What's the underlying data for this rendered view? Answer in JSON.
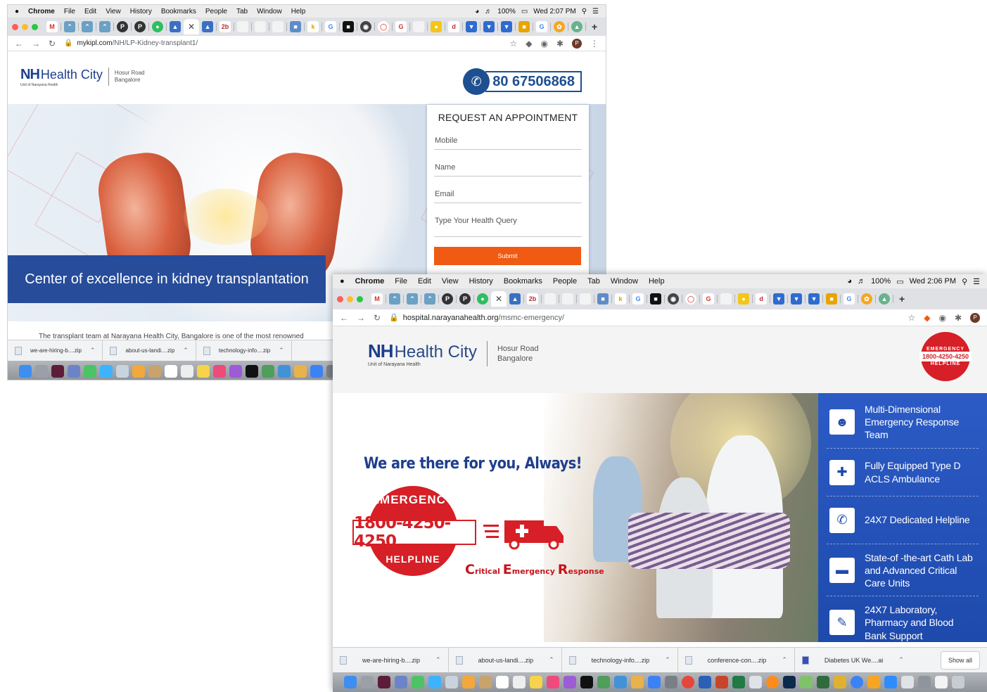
{
  "window_a": {
    "menubar": {
      "apple": "",
      "app": "Chrome",
      "items": [
        "File",
        "Edit",
        "View",
        "History",
        "Bookmarks",
        "People",
        "Tab",
        "Window",
        "Help"
      ],
      "battery": "100%",
      "clock": "Wed 2:07 PM"
    },
    "address": {
      "domain": "mykipl.com",
      "path": "/NH/LP-Kidney-transplant1/"
    },
    "avatar": "P",
    "logo": {
      "nh": "NH",
      "name": "Health City",
      "sub": "Unit of Narayana Health",
      "loc1": "Hosur Road",
      "loc2": "Bangalore"
    },
    "phone": "80 67506868",
    "banner": "Center of excellence in kidney transplantation",
    "form": {
      "title": "REQUEST AN APPOINTMENT",
      "mobile": "Mobile",
      "name": "Name",
      "email": "Email",
      "query": "Type Your Health Query",
      "submit": "Submit"
    },
    "body_text": "The transplant team at Narayana Health City, Bangalore is one of the most renowned",
    "downloads": [
      "we-are-hiring-b....zip",
      "about-us-landi....zip",
      "technology-info....zip"
    ]
  },
  "window_b": {
    "menubar": {
      "app": "Chrome",
      "items": [
        "File",
        "Edit",
        "View",
        "History",
        "Bookmarks",
        "People",
        "Tab",
        "Window",
        "Help"
      ],
      "battery": "100%",
      "clock": "Wed 2:06 PM"
    },
    "address": {
      "domain": "hospital.narayanahealth.org",
      "path": "/msmc-emergency/"
    },
    "avatar": "P",
    "logo": {
      "nh": "NH",
      "name": "Health City",
      "sub": "Unit of Narayana Health",
      "loc1": "Hosur Road",
      "loc2": "Bangalore"
    },
    "badge": {
      "top": "EMERGENCY",
      "number": "1800-4250-4250",
      "bottom": "HELPLINE"
    },
    "tagline": "We are there for you, Always!",
    "seal": {
      "top": "EMERGENCY",
      "number": "1800-4250-4250",
      "bottom": "HELPLINE"
    },
    "cer": {
      "c": "C",
      "ritical": "ritical",
      "e": "E",
      "mergency": "mergency",
      "r": "R",
      "esponse": "esponse"
    },
    "features": [
      {
        "icon": "team-icon",
        "text": "Multi-Dimensional Emergency Response Team"
      },
      {
        "icon": "ambulance-icon",
        "text": "Fully Equipped Type D ACLS Ambulance"
      },
      {
        "icon": "phone-icon",
        "text": "24X7 Dedicated Helpline"
      },
      {
        "icon": "hospital-bed-icon",
        "text": "State-of -the-art Cath Lab and Advanced Critical Care Units"
      },
      {
        "icon": "clipboard-icon",
        "text": "24X7 Laboratory, Pharmacy and Blood Bank Support"
      }
    ],
    "downloads": [
      "we-are-hiring-b....zip",
      "about-us-landi....zip",
      "technology-info....zip",
      "conference-con....zip",
      "Diabetes UK We....ai"
    ],
    "show_all": "Show all"
  }
}
